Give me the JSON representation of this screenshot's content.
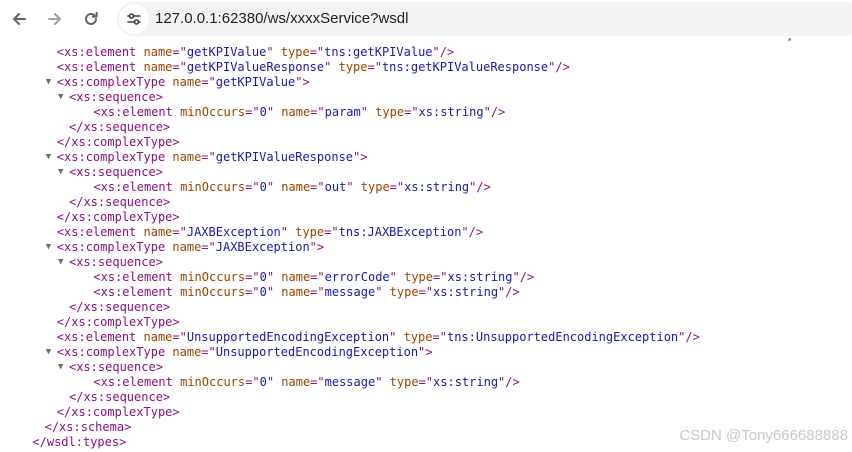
{
  "browser": {
    "url": "127.0.0.1:62380/ws/xxxxService?wsdl",
    "back_icon": "arrow-left-icon",
    "forward_icon": "arrow-right-icon",
    "reload_icon": "reload-icon",
    "site_info_icon": "site-info-icon"
  },
  "xml_top_fragment": "]",
  "xml_lines": [
    {
      "indent": 4,
      "toggle": "",
      "parts": [
        [
          "tag",
          "<xs:element "
        ],
        [
          "attr",
          "name"
        ],
        [
          "tag",
          "=\""
        ],
        [
          "val",
          "getKPIValue"
        ],
        [
          "tag",
          "\" "
        ],
        [
          "attr",
          "type"
        ],
        [
          "tag",
          "=\""
        ],
        [
          "val",
          "tns:getKPIValue"
        ],
        [
          "tag",
          "\"/>"
        ]
      ]
    },
    {
      "indent": 4,
      "toggle": "",
      "parts": [
        [
          "tag",
          "<xs:element "
        ],
        [
          "attr",
          "name"
        ],
        [
          "tag",
          "=\""
        ],
        [
          "val",
          "getKPIValueResponse"
        ],
        [
          "tag",
          "\" "
        ],
        [
          "attr",
          "type"
        ],
        [
          "tag",
          "=\""
        ],
        [
          "val",
          "tns:getKPIValueResponse"
        ],
        [
          "tag",
          "\"/>"
        ]
      ]
    },
    {
      "indent": 4,
      "toggle": "▼",
      "parts": [
        [
          "tag",
          "<xs:complexType "
        ],
        [
          "attr",
          "name"
        ],
        [
          "tag",
          "=\""
        ],
        [
          "val",
          "getKPIValue"
        ],
        [
          "tag",
          "\">"
        ]
      ]
    },
    {
      "indent": 5,
      "toggle": "▼",
      "parts": [
        [
          "tag",
          "<xs:sequence>"
        ]
      ]
    },
    {
      "indent": 7,
      "toggle": "",
      "parts": [
        [
          "tag",
          "<xs:element "
        ],
        [
          "attr",
          "minOccurs"
        ],
        [
          "tag",
          "=\""
        ],
        [
          "val",
          "0"
        ],
        [
          "tag",
          "\" "
        ],
        [
          "attr",
          "name"
        ],
        [
          "tag",
          "=\""
        ],
        [
          "val",
          "param"
        ],
        [
          "tag",
          "\" "
        ],
        [
          "attr",
          "type"
        ],
        [
          "tag",
          "=\""
        ],
        [
          "val",
          "xs:string"
        ],
        [
          "tag",
          "\"/>"
        ]
      ]
    },
    {
      "indent": 5,
      "toggle": "",
      "parts": [
        [
          "tag",
          "</xs:sequence>"
        ]
      ]
    },
    {
      "indent": 4,
      "toggle": "",
      "parts": [
        [
          "tag",
          "</xs:complexType>"
        ]
      ]
    },
    {
      "indent": 4,
      "toggle": "▼",
      "parts": [
        [
          "tag",
          "<xs:complexType "
        ],
        [
          "attr",
          "name"
        ],
        [
          "tag",
          "=\""
        ],
        [
          "val",
          "getKPIValueResponse"
        ],
        [
          "tag",
          "\">"
        ]
      ]
    },
    {
      "indent": 5,
      "toggle": "▼",
      "parts": [
        [
          "tag",
          "<xs:sequence>"
        ]
      ]
    },
    {
      "indent": 7,
      "toggle": "",
      "parts": [
        [
          "tag",
          "<xs:element "
        ],
        [
          "attr",
          "minOccurs"
        ],
        [
          "tag",
          "=\""
        ],
        [
          "val",
          "0"
        ],
        [
          "tag",
          "\" "
        ],
        [
          "attr",
          "name"
        ],
        [
          "tag",
          "=\""
        ],
        [
          "val",
          "out"
        ],
        [
          "tag",
          "\" "
        ],
        [
          "attr",
          "type"
        ],
        [
          "tag",
          "=\""
        ],
        [
          "val",
          "xs:string"
        ],
        [
          "tag",
          "\"/>"
        ]
      ]
    },
    {
      "indent": 5,
      "toggle": "",
      "parts": [
        [
          "tag",
          "</xs:sequence>"
        ]
      ]
    },
    {
      "indent": 4,
      "toggle": "",
      "parts": [
        [
          "tag",
          "</xs:complexType>"
        ]
      ]
    },
    {
      "indent": 4,
      "toggle": "",
      "parts": [
        [
          "tag",
          "<xs:element "
        ],
        [
          "attr",
          "name"
        ],
        [
          "tag",
          "=\""
        ],
        [
          "val",
          "JAXBException"
        ],
        [
          "tag",
          "\" "
        ],
        [
          "attr",
          "type"
        ],
        [
          "tag",
          "=\""
        ],
        [
          "val",
          "tns:JAXBException"
        ],
        [
          "tag",
          "\"/>"
        ]
      ]
    },
    {
      "indent": 4,
      "toggle": "▼",
      "parts": [
        [
          "tag",
          "<xs:complexType "
        ],
        [
          "attr",
          "name"
        ],
        [
          "tag",
          "=\""
        ],
        [
          "val",
          "JAXBException"
        ],
        [
          "tag",
          "\">"
        ]
      ]
    },
    {
      "indent": 5,
      "toggle": "▼",
      "parts": [
        [
          "tag",
          "<xs:sequence>"
        ]
      ]
    },
    {
      "indent": 7,
      "toggle": "",
      "parts": [
        [
          "tag",
          "<xs:element "
        ],
        [
          "attr",
          "minOccurs"
        ],
        [
          "tag",
          "=\""
        ],
        [
          "val",
          "0"
        ],
        [
          "tag",
          "\" "
        ],
        [
          "attr",
          "name"
        ],
        [
          "tag",
          "=\""
        ],
        [
          "val",
          "errorCode"
        ],
        [
          "tag",
          "\" "
        ],
        [
          "attr",
          "type"
        ],
        [
          "tag",
          "=\""
        ],
        [
          "val",
          "xs:string"
        ],
        [
          "tag",
          "\"/>"
        ]
      ]
    },
    {
      "indent": 7,
      "toggle": "",
      "parts": [
        [
          "tag",
          "<xs:element "
        ],
        [
          "attr",
          "minOccurs"
        ],
        [
          "tag",
          "=\""
        ],
        [
          "val",
          "0"
        ],
        [
          "tag",
          "\" "
        ],
        [
          "attr",
          "name"
        ],
        [
          "tag",
          "=\""
        ],
        [
          "val",
          "message"
        ],
        [
          "tag",
          "\" "
        ],
        [
          "attr",
          "type"
        ],
        [
          "tag",
          "=\""
        ],
        [
          "val",
          "xs:string"
        ],
        [
          "tag",
          "\"/>"
        ]
      ]
    },
    {
      "indent": 5,
      "toggle": "",
      "parts": [
        [
          "tag",
          "</xs:sequence>"
        ]
      ]
    },
    {
      "indent": 4,
      "toggle": "",
      "parts": [
        [
          "tag",
          "</xs:complexType>"
        ]
      ]
    },
    {
      "indent": 4,
      "toggle": "",
      "parts": [
        [
          "tag",
          "<xs:element "
        ],
        [
          "attr",
          "name"
        ],
        [
          "tag",
          "=\""
        ],
        [
          "val",
          "UnsupportedEncodingException"
        ],
        [
          "tag",
          "\" "
        ],
        [
          "attr",
          "type"
        ],
        [
          "tag",
          "=\""
        ],
        [
          "val",
          "tns:UnsupportedEncodingException"
        ],
        [
          "tag",
          "\"/>"
        ]
      ]
    },
    {
      "indent": 4,
      "toggle": "▼",
      "parts": [
        [
          "tag",
          "<xs:complexType "
        ],
        [
          "attr",
          "name"
        ],
        [
          "tag",
          "=\""
        ],
        [
          "val",
          "UnsupportedEncodingException"
        ],
        [
          "tag",
          "\">"
        ]
      ]
    },
    {
      "indent": 5,
      "toggle": "▼",
      "parts": [
        [
          "tag",
          "<xs:sequence>"
        ]
      ]
    },
    {
      "indent": 7,
      "toggle": "",
      "parts": [
        [
          "tag",
          "<xs:element "
        ],
        [
          "attr",
          "minOccurs"
        ],
        [
          "tag",
          "=\""
        ],
        [
          "val",
          "0"
        ],
        [
          "tag",
          "\" "
        ],
        [
          "attr",
          "name"
        ],
        [
          "tag",
          "=\""
        ],
        [
          "val",
          "message"
        ],
        [
          "tag",
          "\" "
        ],
        [
          "attr",
          "type"
        ],
        [
          "tag",
          "=\""
        ],
        [
          "val",
          "xs:string"
        ],
        [
          "tag",
          "\"/>"
        ]
      ]
    },
    {
      "indent": 5,
      "toggle": "",
      "parts": [
        [
          "tag",
          "</xs:sequence>"
        ]
      ]
    },
    {
      "indent": 4,
      "toggle": "",
      "parts": [
        [
          "tag",
          "</xs:complexType>"
        ]
      ]
    },
    {
      "indent": 3,
      "toggle": "",
      "parts": [
        [
          "tag",
          "</xs:schema>"
        ]
      ]
    },
    {
      "indent": 2,
      "toggle": "",
      "parts": [
        [
          "tag",
          "</wsdl:types>"
        ]
      ]
    }
  ],
  "watermark": "CSDN @Tony666688888"
}
